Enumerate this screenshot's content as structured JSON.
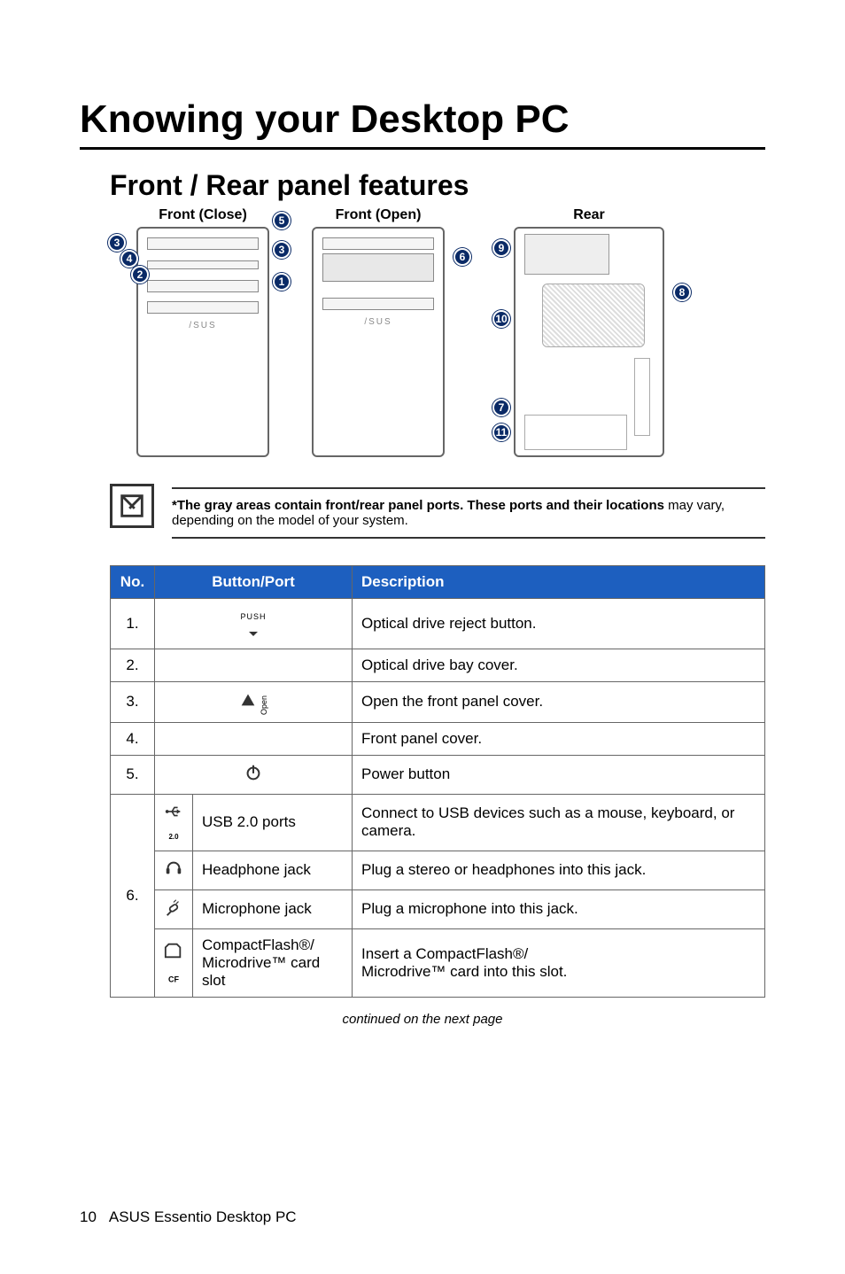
{
  "titles": {
    "main": "Knowing your Desktop PC",
    "section": "Front / Rear panel features"
  },
  "diagram_labels": {
    "front_close": "Front (Close)",
    "front_open": "Front (Open)",
    "rear": "Rear"
  },
  "callouts": {
    "n1": "1",
    "n2": "2",
    "n3": "3",
    "n4": "4",
    "n5": "5",
    "n6": "6",
    "n7": "7",
    "n8": "8",
    "n9": "9",
    "n10": "10",
    "n11": "11"
  },
  "note": {
    "bold": "*The gray areas contain front/rear panel ports. These ports and their locations ",
    "rest": "may vary, depending on the model of your system."
  },
  "table": {
    "headers": {
      "no": "No.",
      "button_port": "Button/Port",
      "description": "Description"
    },
    "rows": [
      {
        "no": "1.",
        "icon": "push",
        "name": "",
        "desc": "Optical drive reject button."
      },
      {
        "no": "2.",
        "icon": "",
        "name": "",
        "desc": "Optical drive bay cover."
      },
      {
        "no": "3.",
        "icon": "open",
        "name": "",
        "desc": "Open the front panel cover."
      },
      {
        "no": "4.",
        "icon": "",
        "name": "",
        "desc": "Front panel cover."
      },
      {
        "no": "5.",
        "icon": "power",
        "name": "",
        "desc": "Power button"
      }
    ],
    "row6": {
      "no": "6.",
      "sub": [
        {
          "icon": "usb",
          "name": "USB 2.0 ports",
          "desc": "Connect to USB devices such as a mouse, keyboard, or camera."
        },
        {
          "icon": "headphone",
          "name": "Headphone jack",
          "desc": "Plug a stereo or headphones into this jack."
        },
        {
          "icon": "mic",
          "name": "Microphone jack",
          "desc": "Plug a microphone into this jack."
        },
        {
          "icon": "cf",
          "name": "CompactFlash®/\nMicrodrive™ card slot",
          "desc": "Insert a CompactFlash®/\nMicrodrive™ card into this slot."
        }
      ]
    }
  },
  "continued": "continued on the next page",
  "footer": {
    "page": "10",
    "text": "ASUS Essentio Desktop PC"
  }
}
